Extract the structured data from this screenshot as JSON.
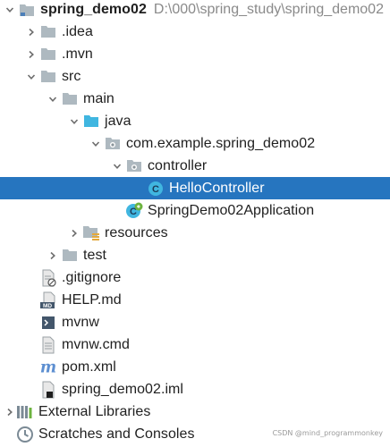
{
  "project": {
    "name": "spring_demo02",
    "path": "D:\\000\\spring_study\\spring_demo02"
  },
  "tree": {
    "idea": ".idea",
    "mvn": ".mvn",
    "src": "src",
    "main": "main",
    "java": "java",
    "package": "com.example.spring_demo02",
    "controller": "controller",
    "hello_controller": "HelloController",
    "application": "SpringDemo02Application",
    "resources": "resources",
    "test": "test",
    "gitignore": ".gitignore",
    "help_md": "HELP.md",
    "mvnw": "mvnw",
    "mvnw_cmd": "mvnw.cmd",
    "pom_xml": "pom.xml",
    "iml": "spring_demo02.iml",
    "external_libraries": "External Libraries",
    "scratches": "Scratches and Consoles"
  },
  "icons": {
    "module": "module-folder-icon",
    "folder": "folder-icon",
    "source_root": "source-root-icon",
    "package": "package-icon",
    "class": "class-icon",
    "spring_boot_app": "spring-boot-app-icon",
    "resources": "resources-folder-icon",
    "file": "file-icon",
    "markdown": "markdown-icon",
    "shell": "shell-script-icon",
    "maven": "maven-icon",
    "iml": "iml-icon",
    "libraries": "libraries-icon",
    "scratches": "scratches-icon"
  },
  "colors": {
    "selection": "#2675bf",
    "folder": "#aeb9c0",
    "source_folder": "#40b6e0",
    "class": "#40b6e0",
    "spring": "#6db33f",
    "maven": "#5d8fd1"
  },
  "watermark": "CSDN @mind_programmonkey"
}
